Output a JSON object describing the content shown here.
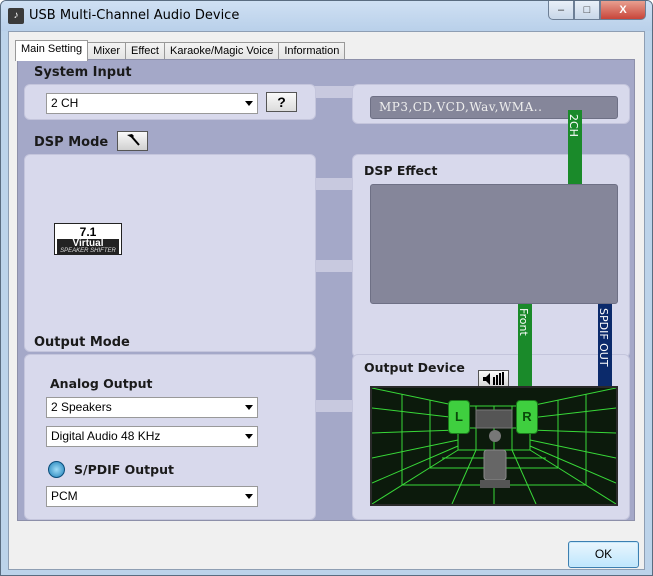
{
  "window": {
    "title": "USB Multi-Channel Audio Device",
    "minimize_label": "–",
    "maximize_label": "□",
    "close_label": "X"
  },
  "tabs": [
    {
      "label": "Main Setting",
      "active": true
    },
    {
      "label": "Mixer",
      "active": false
    },
    {
      "label": "Effect",
      "active": false
    },
    {
      "label": "Karaoke/Magic Voice",
      "active": false
    },
    {
      "label": "Information",
      "active": false
    }
  ],
  "system_input": {
    "title": "System Input",
    "selected": "2 CH",
    "help_label": "?",
    "source_display": "MP3,CD,VCD,Wav,WMA..",
    "channel_bar": "2CH"
  },
  "dsp_mode": {
    "title": "DSP Mode",
    "logo": {
      "line1": "7.1",
      "line2": "Virtual",
      "line3": "SPEAKER SHIFTER"
    }
  },
  "dsp_effect": {
    "title": "DSP Effect",
    "front_bar": "Front",
    "spdif_bar": "SPDIF OUT"
  },
  "output_mode": {
    "title": "Output Mode",
    "analog_title": "Analog Output",
    "speakers_selected": "2 Speakers",
    "sample_rate_selected": "Digital Audio 48 KHz",
    "spdif_title": "S/PDIF Output",
    "spdif_selected": "PCM"
  },
  "output_device": {
    "title": "Output Device",
    "left_speaker": "L",
    "right_speaker": "R"
  },
  "footer": {
    "ok_label": "OK"
  },
  "colors": {
    "panel_bg": "#a4a8c8",
    "box_bg": "#d8d9ec",
    "green_bar": "#1a8a2a",
    "blue_bar": "#0b2a6b",
    "room_grid": "#38d838"
  }
}
